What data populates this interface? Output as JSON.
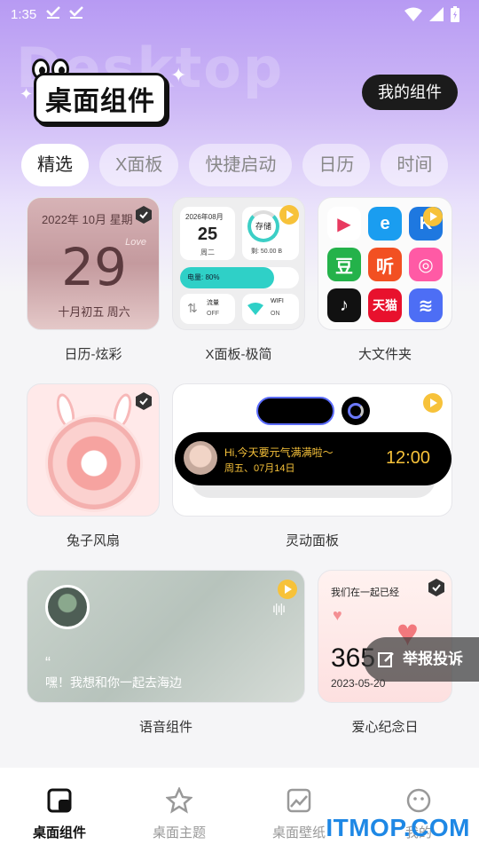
{
  "status_bar": {
    "time": "1:35"
  },
  "header": {
    "bg_word": "Desktop",
    "logo_text": "桌面组件",
    "my_widgets_button": "我的组件"
  },
  "tabs": [
    "精选",
    "X面板",
    "快捷启动",
    "日历",
    "时间"
  ],
  "widgets": {
    "calendar": {
      "caption": "日历-炫彩",
      "top_line": "2022年 10月 星期",
      "decor_word": "Love",
      "day": "29",
      "lunar": "十月初五 周六"
    },
    "xpanel": {
      "caption": "X面板-极简",
      "date_header": "2026年08月",
      "day": "25",
      "weekday": "周二",
      "storage_label": "存储",
      "storage_remaining": "剩: 50.00 B",
      "battery": "电量: 80%",
      "data_label": "流量",
      "data_state": "OFF",
      "wifi_label": "WIFI",
      "wifi_state": "ON"
    },
    "folder": {
      "caption": "大文件夹"
    },
    "fan": {
      "caption": "兔子风扇"
    },
    "dynamic": {
      "caption": "灵动面板",
      "message": "Hi,今天要元气满满啦～",
      "date": "周五、07月14日",
      "time": "12:00"
    },
    "voice": {
      "caption": "语音组件",
      "quote": "嘿！我想和你一起去海边"
    },
    "love": {
      "caption": "爱心纪念日",
      "title": "我们在一起已经",
      "days": "365",
      "date": "2023-05-20"
    }
  },
  "report_button": "举报投诉",
  "bottom_nav": [
    "桌面组件",
    "桌面主题",
    "桌面壁纸",
    "我的"
  ],
  "watermark": "ITMOP.COM",
  "colors": {
    "accent": "#f7c23a",
    "header": "#b79af3",
    "dark": "#1b1b1b"
  }
}
